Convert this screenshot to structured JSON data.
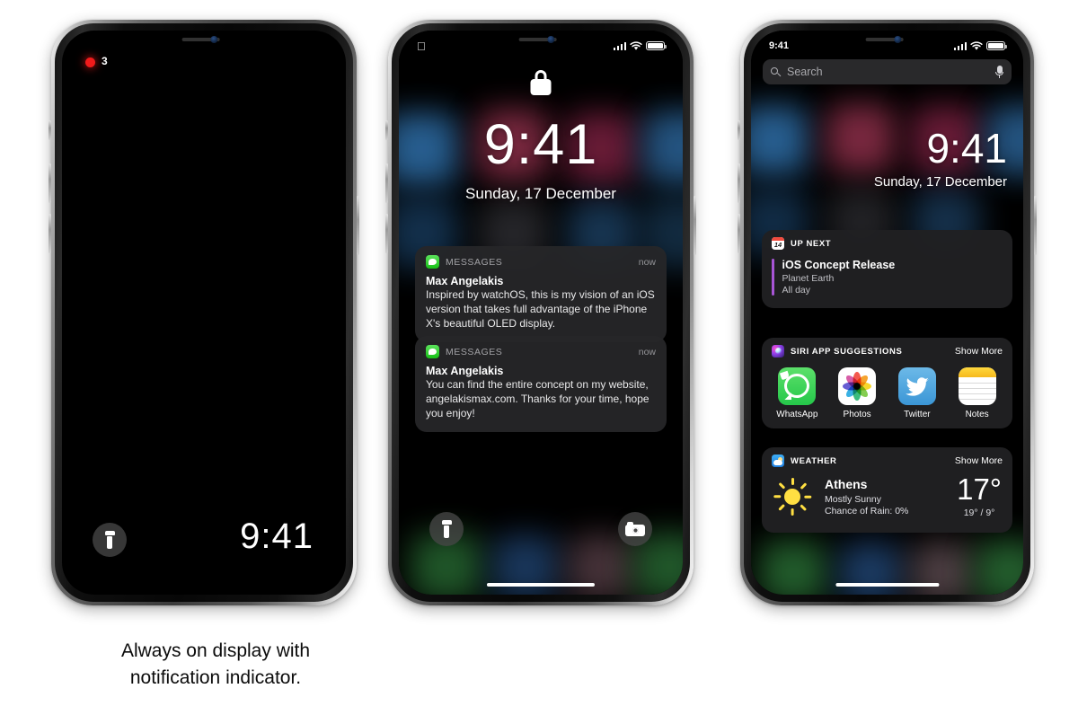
{
  "caption": "Always on display with\nnotification indicator.",
  "caption_line1": "Always on display with",
  "caption_line2": "notification indicator.",
  "colors": {
    "notification_dot": "#f01b1b",
    "accent_purple": "#a855d6",
    "whatsapp_green": "#25c74a",
    "twitter_blue": "#3b96d6",
    "notes_yellow": "#f6b91d",
    "calendar_red": "#f24b3e",
    "sun_yellow": "#ffdf42"
  },
  "phone1": {
    "name": "always-on-display",
    "notification_count": "3",
    "clock": "9:41",
    "flashlight_icon": "flashlight-icon"
  },
  "phone2": {
    "name": "lock-screen",
    "statusbar": {
      "apple_logo": "apple-logo",
      "signal_icon": "cellular-signal-icon",
      "wifi_icon": "wifi-icon",
      "battery_icon": "battery-icon"
    },
    "lock_icon": "lock-icon",
    "clock": "9:41",
    "date": "Sunday, 17 December",
    "notifications": [
      {
        "app": "MESSAGES",
        "app_icon": "messages-icon",
        "time": "now",
        "title": "Max Angelakis",
        "body": "Inspired by watchOS, this is my vision of an iOS version that takes full advantage of the iPhone X's beautiful OLED display."
      },
      {
        "app": "MESSAGES",
        "app_icon": "messages-icon",
        "time": "now",
        "title": "Max Angelakis",
        "body": "You can find the entire concept on my website, angelakismax.com. Thanks for your time, hope you enjoy!"
      }
    ],
    "flashlight_icon": "flashlight-icon",
    "camera_icon": "camera-icon"
  },
  "phone3": {
    "name": "today-view",
    "statusbar": {
      "time": "9:41",
      "signal_icon": "cellular-signal-icon",
      "wifi_icon": "wifi-icon",
      "battery_icon": "battery-icon"
    },
    "search": {
      "placeholder": "Search",
      "search_icon": "search-icon",
      "mic_icon": "microphone-icon"
    },
    "clock": "9:41",
    "date": "Sunday, 17 December",
    "widgets": {
      "up_next": {
        "title": "UP NEXT",
        "icon": "calendar-icon",
        "icon_day": "14",
        "event_title": "iOS Concept Release",
        "event_location": "Planet Earth",
        "event_time": "All day"
      },
      "siri_suggestions": {
        "title": "SIRI APP SUGGESTIONS",
        "icon": "siri-icon",
        "show_more": "Show More",
        "apps": [
          {
            "label": "WhatsApp",
            "icon": "whatsapp-icon"
          },
          {
            "label": "Photos",
            "icon": "photos-icon"
          },
          {
            "label": "Twitter",
            "icon": "twitter-icon"
          },
          {
            "label": "Notes",
            "icon": "notes-icon"
          }
        ]
      },
      "weather": {
        "title": "WEATHER",
        "icon": "weather-icon",
        "show_more": "Show More",
        "condition_icon": "sun-icon",
        "city": "Athens",
        "condition": "Mostly Sunny",
        "rain": "Chance of Rain: 0%",
        "temp": "17°",
        "high_low": "19° / 9°"
      }
    }
  }
}
